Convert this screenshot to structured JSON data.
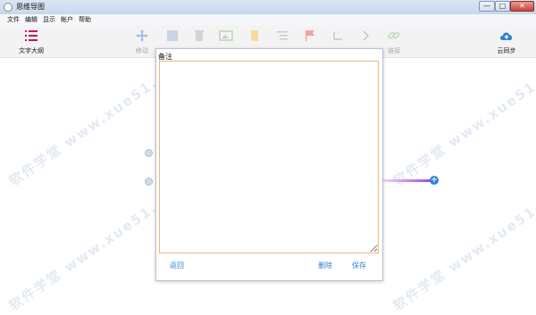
{
  "window": {
    "title": "思维导图",
    "buttons": {
      "minimize": "—",
      "maximize": "□",
      "close": "✕"
    }
  },
  "menu": [
    "文件",
    "编辑",
    "显示",
    "帐户",
    "帮助"
  ],
  "toolbar": {
    "outline_label": "文字大纲",
    "move_label": "移动",
    "link_label": "链接",
    "cloud_label": "云同步",
    "disabled_tools": [
      "image",
      "delete",
      "photo",
      "note",
      "list",
      "flag",
      "undo",
      "redo"
    ]
  },
  "dialog": {
    "title": "备注",
    "note_value": "",
    "back_label": "返回",
    "delete_label": "删除",
    "save_label": "保存"
  },
  "watermark": "软件学堂 www.xue51.com",
  "colors": {
    "accent": "#2d7fd1",
    "branch": "#a44bd6",
    "outline_icon": "#c2185b",
    "cloud_icon": "#2f7fd9"
  }
}
